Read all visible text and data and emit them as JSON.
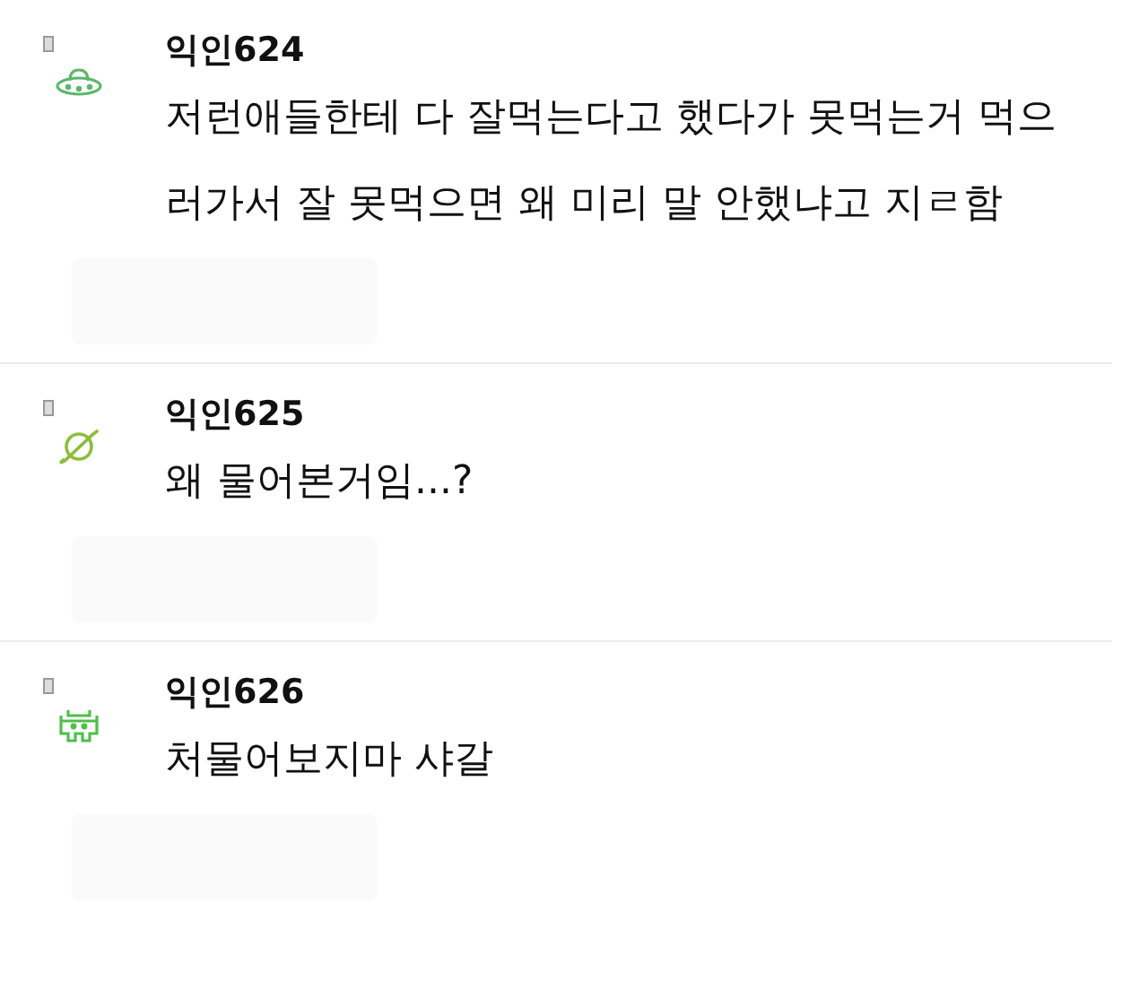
{
  "comments": [
    {
      "avatar": {
        "kind": "ufo",
        "color": "#5cb86a"
      },
      "author": "익인624",
      "lines": [
        "저런애들한테 다 잘먹는다고 했다가 못먹는거 먹으",
        "러가서 잘 못먹으면 왜 미리 말 안했냐고 지ㄹ함"
      ]
    },
    {
      "avatar": {
        "kind": "planet",
        "color": "#8dbd3c"
      },
      "author": "익인625",
      "lines": [
        "왜 물어본거임...?"
      ]
    },
    {
      "avatar": {
        "kind": "invader",
        "color": "#4fbf4a"
      },
      "author": "익인626",
      "lines": [
        "처물어보지마 샤갈"
      ]
    }
  ]
}
